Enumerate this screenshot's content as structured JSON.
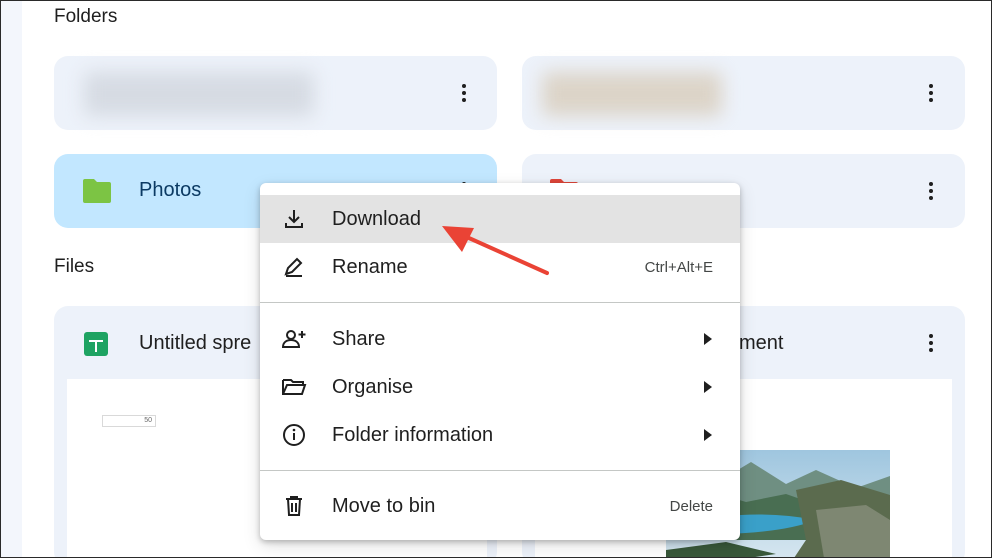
{
  "sections": {
    "folders_title": "Folders",
    "files_title": "Files"
  },
  "folders": [
    {
      "name": "",
      "blurred": true
    },
    {
      "name": "",
      "blurred": true
    },
    {
      "name": "Photos",
      "icon": "folder-icon",
      "icon_color": "#7cc444",
      "selected": true
    },
    {
      "name": "",
      "icon": "folder-icon",
      "icon_color": "#e0463a"
    }
  ],
  "files": [
    {
      "name": "Untitled spre",
      "icon": "google-sheets-icon",
      "icon_color": "#1ea362",
      "thumbnail_cell_value": "50"
    },
    {
      "name": "ment",
      "icon": "google-docs-icon"
    }
  ],
  "context_menu": {
    "items": [
      {
        "label": "Download",
        "icon": "download-icon",
        "active": true
      },
      {
        "label": "Rename",
        "icon": "rename-icon",
        "shortcut": "Ctrl+Alt+E"
      },
      {
        "label": "Share",
        "icon": "share-icon",
        "submenu": true
      },
      {
        "label": "Organise",
        "icon": "folder-open-icon",
        "submenu": true
      },
      {
        "label": "Folder information",
        "icon": "info-icon",
        "submenu": true
      },
      {
        "label": "Move to bin",
        "icon": "trash-icon",
        "shortcut": "Delete"
      }
    ]
  },
  "annotation": {
    "icon": "red-arrow-icon",
    "color": "#ea4335"
  },
  "colors": {
    "card_bg": "#edf2fa",
    "selected_card_bg": "#c2e7ff",
    "menu_hover": "#e3e3e3"
  }
}
